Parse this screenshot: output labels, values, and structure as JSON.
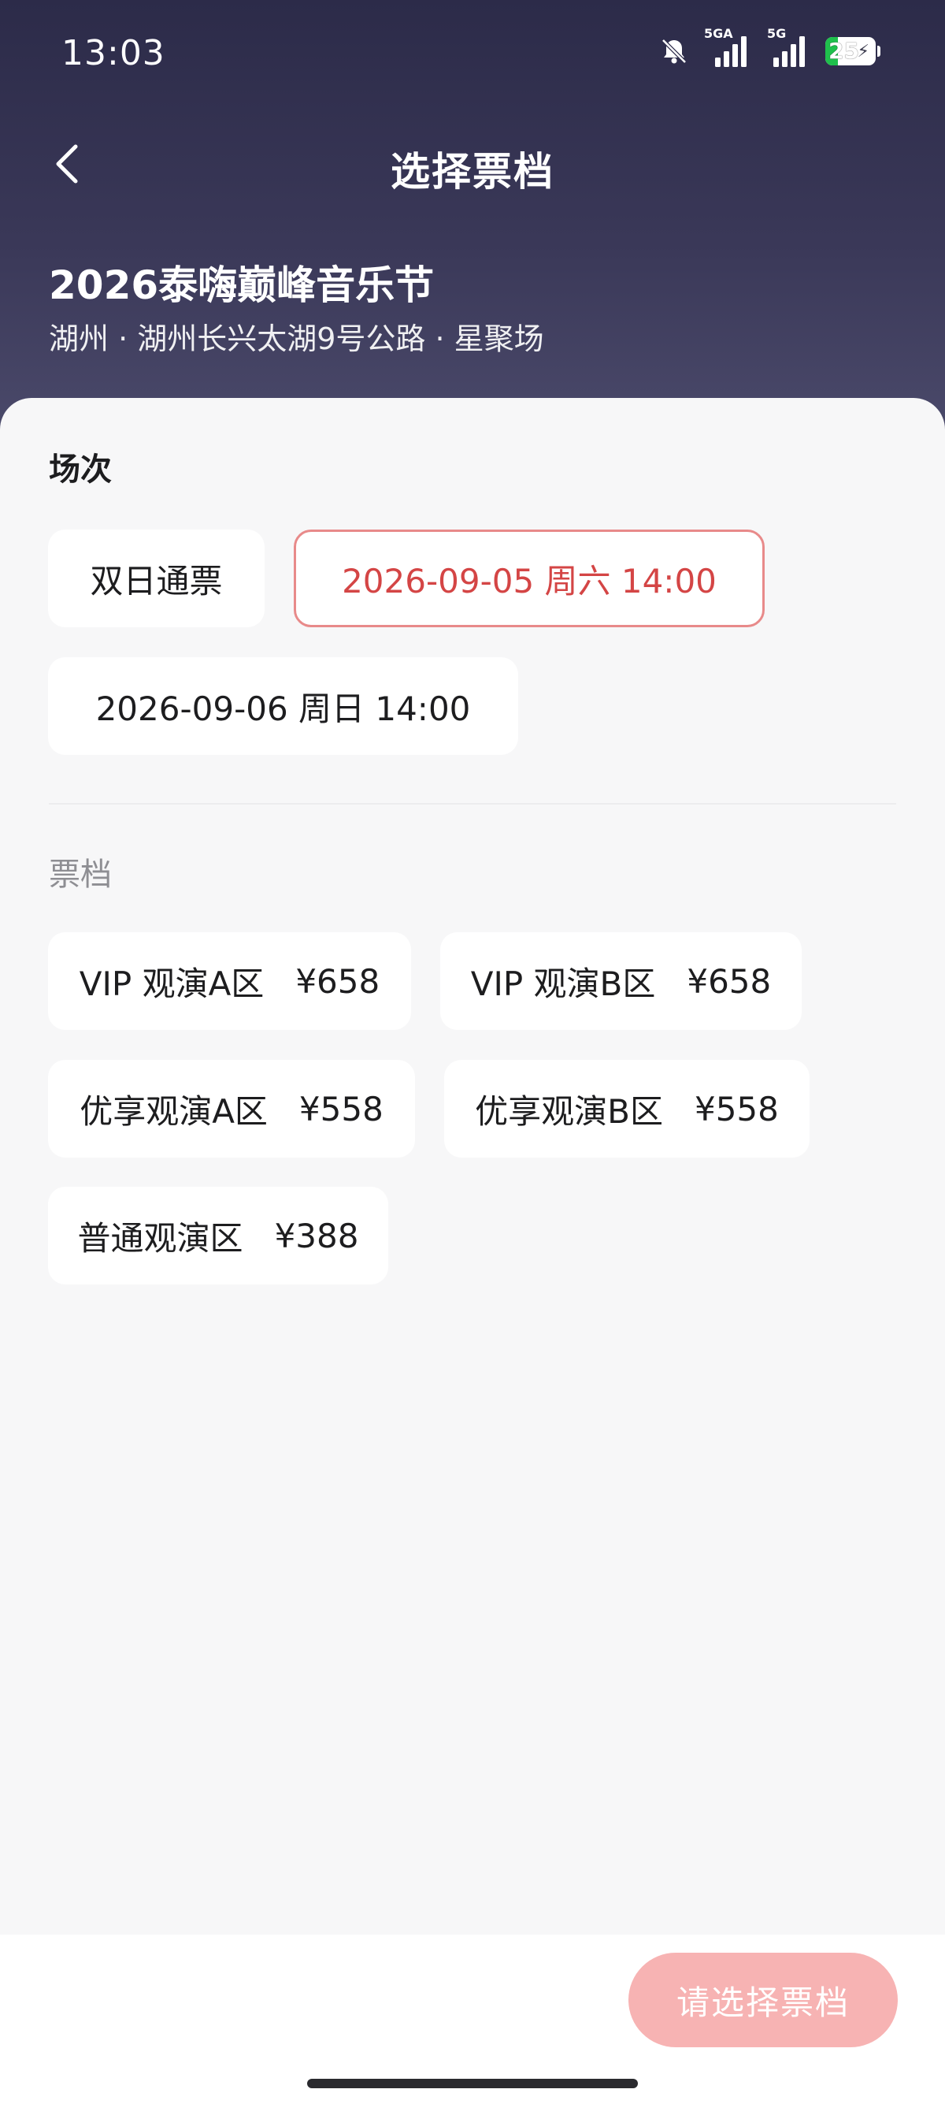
{
  "status_bar": {
    "time": "13:03",
    "signal_1_label": "5GA",
    "signal_2_label": "5G",
    "battery_level": "25",
    "battery_fraction": 0.25,
    "battery_charging": true,
    "icons": [
      "bell-muted-icon",
      "signal-icon",
      "signal-icon",
      "battery-icon",
      "charging-bolt-icon"
    ]
  },
  "nav": {
    "title": "选择票档",
    "back_icon": "chevron-left-icon"
  },
  "event": {
    "title": "2026泰嗨巅峰音乐节",
    "venue": "湖州 · 湖州长兴太湖9号公路 · 星聚场"
  },
  "sessions": {
    "label": "场次",
    "items": [
      {
        "label": "双日通票",
        "selected": false
      },
      {
        "label": "2026-09-05 周六 14:00",
        "selected": true
      },
      {
        "label": "2026-09-06 周日 14:00",
        "selected": false
      }
    ]
  },
  "tiers": {
    "label": "票档",
    "items": [
      {
        "name": "VIP 观演A区",
        "price": "¥658"
      },
      {
        "name": "VIP 观演B区",
        "price": "¥658"
      },
      {
        "name": "优享观演A区",
        "price": "¥558"
      },
      {
        "name": "优享观演B区",
        "price": "¥558"
      },
      {
        "name": "普通观演区",
        "price": "¥388"
      }
    ]
  },
  "footer": {
    "confirm_label": "请选择票档"
  },
  "colors": {
    "header_top": "#2c2b49",
    "header_bottom": "#4b4a6b",
    "accent": "#d44545",
    "selected_border": "#e88a8a",
    "confirm_disabled": "#f7b3b3",
    "background": "#f7f7f8"
  }
}
